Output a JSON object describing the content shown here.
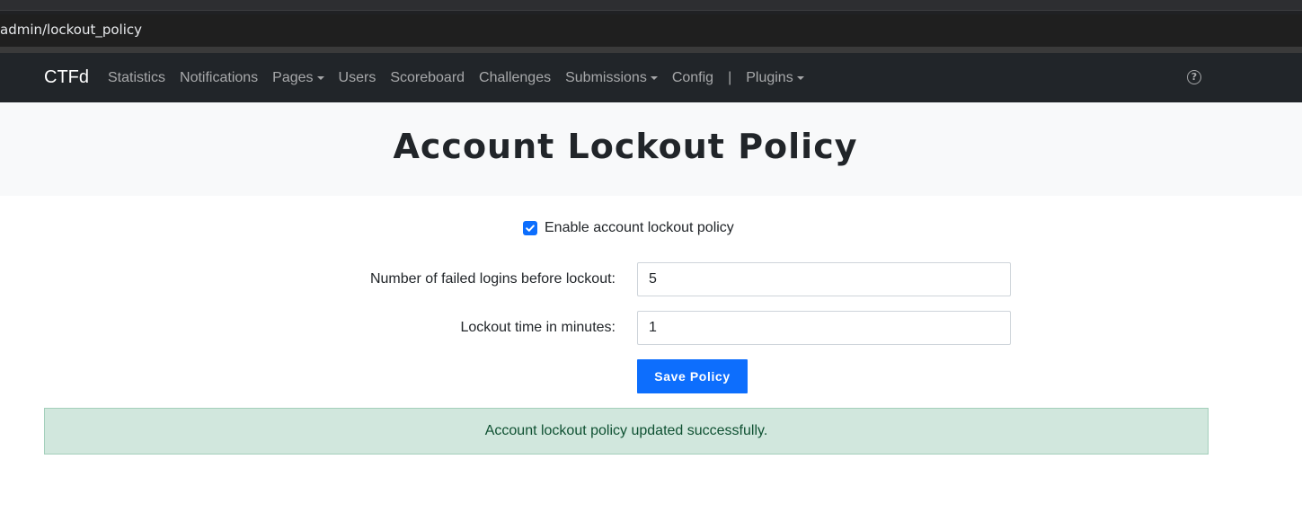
{
  "browser": {
    "url": "admin/lockout_policy"
  },
  "navbar": {
    "brand": "CTFd",
    "items": [
      {
        "label": "Statistics",
        "dropdown": false
      },
      {
        "label": "Notifications",
        "dropdown": false
      },
      {
        "label": "Pages",
        "dropdown": true
      },
      {
        "label": "Users",
        "dropdown": false
      },
      {
        "label": "Scoreboard",
        "dropdown": false
      },
      {
        "label": "Challenges",
        "dropdown": false
      },
      {
        "label": "Submissions",
        "dropdown": true
      },
      {
        "label": "Config",
        "dropdown": false
      }
    ],
    "divider": "|",
    "plugins_label": "Plugins",
    "help_icon": "question-circle-icon",
    "help_glyph": "?"
  },
  "page": {
    "title": "Account Lockout Policy"
  },
  "form": {
    "enable_label": "Enable account lockout policy",
    "enable_checked": true,
    "failed_logins_label": "Number of failed logins before lockout:",
    "failed_logins_value": "5",
    "lockout_time_label": "Lockout time in minutes:",
    "lockout_time_value": "1",
    "save_label": "Save Policy"
  },
  "alert": {
    "message": "Account lockout policy updated successfully."
  },
  "colors": {
    "navbar_bg": "#212529",
    "primary": "#0d6efd",
    "success_bg": "#d1e7dd",
    "success_text": "#0f5132"
  }
}
